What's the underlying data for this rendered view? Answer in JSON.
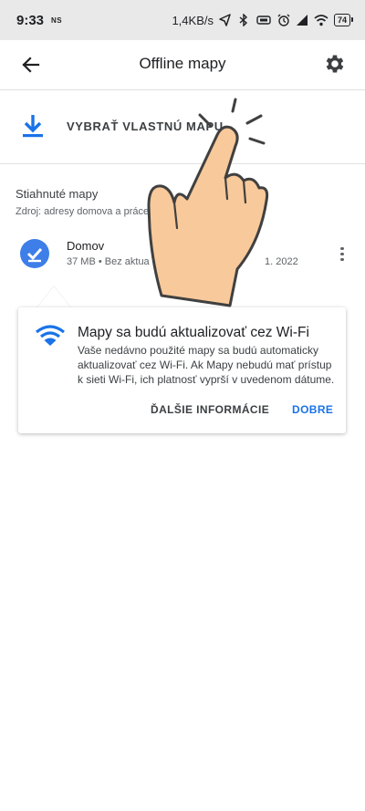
{
  "status_bar": {
    "time": "9:33",
    "ns_label": "NS",
    "network_speed": "1,4KB/s",
    "battery": "74"
  },
  "app_bar": {
    "title": "Offline mapy",
    "back_icon": "arrow-back-icon",
    "settings_icon": "gear-icon"
  },
  "select_map": {
    "label": "VYBRAŤ VLASTNÚ MAPU",
    "icon": "download-icon"
  },
  "downloaded": {
    "title": "Stiahnuté mapy",
    "source": "Zdroj: adresy domova a práce",
    "items": [
      {
        "name": "Domov",
        "meta": "37 MB • Bez aktua",
        "date": "1. 2022"
      }
    ]
  },
  "tooltip": {
    "title": "Mapy sa budú aktualizovať cez Wi-Fi",
    "body": "Vaše nedávno použité mapy sa budú automaticky aktualizovať cez Wi-Fi. Ak Mapy nebudú mať prístup k sieti Wi-Fi, ich platnosť vyprší v uvedenom dátume.",
    "more_button": "ĎALŠIE INFORMÁCIE",
    "ok_button": "DOBRE",
    "icon": "wifi-icon"
  },
  "colors": {
    "accent": "#1a73e8",
    "check_bg": "#3d7ee8",
    "hand_fill": "#f8c99a"
  }
}
